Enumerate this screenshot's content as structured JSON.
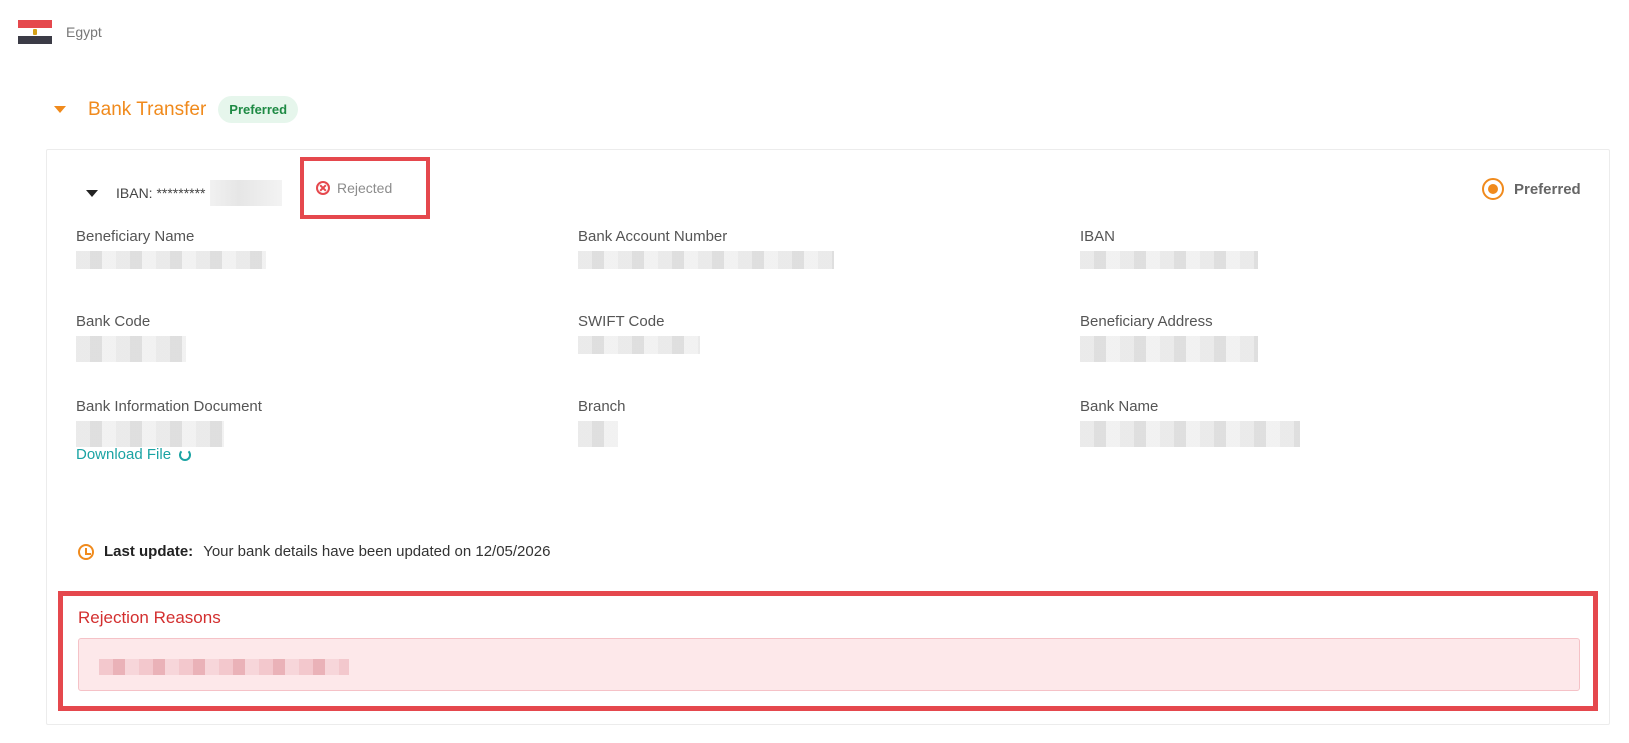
{
  "country": {
    "name": "Egypt",
    "flag": "egypt-flag"
  },
  "section": {
    "title": "Bank Transfer",
    "badge": "Preferred"
  },
  "account": {
    "iban_label": "IBAN: *********",
    "status": "Rejected",
    "preferred_label": "Preferred"
  },
  "fields": {
    "beneficiary_name": "Beneficiary Name",
    "bank_account_number": "Bank Account Number",
    "iban": "IBAN",
    "bank_code": "Bank Code",
    "swift_code": "SWIFT Code",
    "beneficiary_address": "Beneficiary Address",
    "bank_information_document": "Bank Information Document",
    "branch": "Branch",
    "bank_name": "Bank Name"
  },
  "download_label": "Download File",
  "last_update": {
    "label": "Last update:",
    "text": "Your bank details have been updated on 12/05/2026"
  },
  "rejection": {
    "title": "Rejection Reasons"
  },
  "colors": {
    "accent": "#f08a1c",
    "danger": "#e5484d",
    "success": "#1e8a44",
    "link": "#1aa3a3"
  }
}
